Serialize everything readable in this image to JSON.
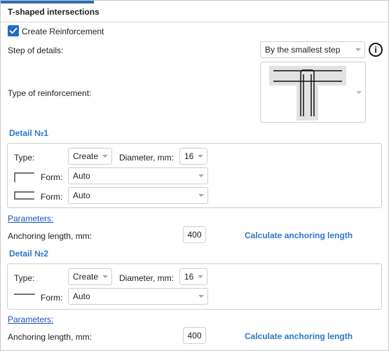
{
  "header": {
    "title": "T-shaped intersections"
  },
  "create_reinforcement": {
    "label": "Create Reinforcement",
    "checked": true
  },
  "step_of_details": {
    "label": "Step of details:",
    "value": "By the smallest step"
  },
  "type_of_reinforcement": {
    "label": "Type of reinforcement:"
  },
  "detail1": {
    "title": "Detail №1",
    "type_label": "Type:",
    "type_value": "Create",
    "diameter_label": "Diameter, mm:",
    "diameter_value": "16",
    "form1_label": "Form:",
    "form1_value": "Auto",
    "form2_label": "Form:",
    "form2_value": "Auto",
    "parameters_link": "Parameters:",
    "anchoring_label": "Anchoring length, mm:",
    "anchoring_value": "400",
    "calc_button": "Calculate anchoring length"
  },
  "detail2": {
    "title": "Detail №2",
    "type_label": "Type:",
    "type_value": "Create",
    "diameter_label": "Diameter, mm:",
    "diameter_value": "16",
    "form_label": "Form:",
    "form_value": "Auto",
    "parameters_link": "Parameters:",
    "anchoring_label": "Anchoring length, mm:",
    "anchoring_value": "400",
    "calc_button": "Calculate anchoring length"
  },
  "colors": {
    "accent": "#2a78c6",
    "link": "#1b55b8",
    "checkbox": "#1f6fc0",
    "tab_accent": "#2f6fb3"
  }
}
